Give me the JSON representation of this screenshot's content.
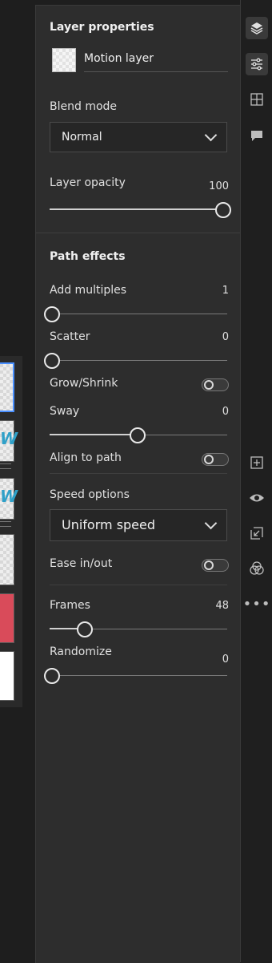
{
  "layer_properties": {
    "title": "Layer properties",
    "layer_name": "Motion layer",
    "blend_mode_label": "Blend mode",
    "blend_mode_value": "Normal",
    "opacity_label": "Layer opacity",
    "opacity_value": "100",
    "opacity_percent": 100
  },
  "path_effects": {
    "title": "Path effects",
    "add_multiples": {
      "label": "Add multiples",
      "value": "1",
      "fraction": 0.0
    },
    "scatter": {
      "label": "Scatter",
      "value": "0",
      "fraction": 0.0
    },
    "grow_shrink": {
      "label": "Grow/Shrink",
      "on": false
    },
    "sway": {
      "label": "Sway",
      "value": "0",
      "fraction": 0.5
    },
    "align_to_path": {
      "label": "Align to path",
      "on": false
    },
    "speed_options_label": "Speed options",
    "speed_options_value": "Uniform speed",
    "ease": {
      "label": "Ease in/out",
      "on": false
    },
    "frames": {
      "label": "Frames",
      "value": "48",
      "fraction": 0.19
    },
    "randomize": {
      "label": "Randomize",
      "value": "0",
      "fraction": 0.0
    }
  },
  "right_toolbar": [
    "layers-icon",
    "properties-icon",
    "grid-icon",
    "comment-icon",
    "add-layer-icon",
    "visibility-icon",
    "import-icon",
    "blend-icon",
    "more-icon"
  ]
}
